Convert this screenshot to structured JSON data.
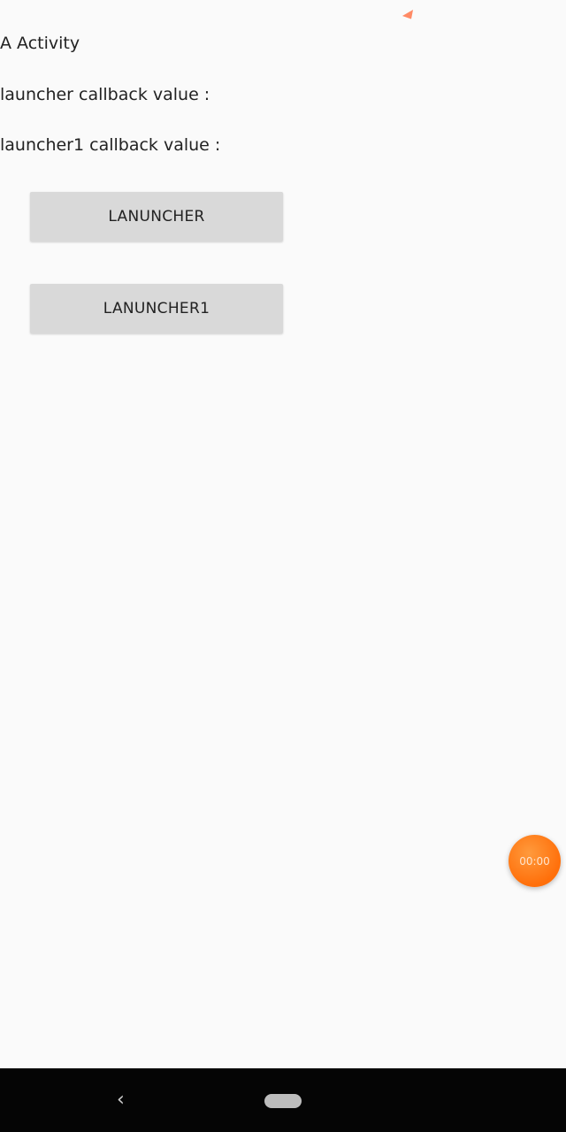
{
  "main": {
    "title": "A Activity",
    "launcher_callback_label": "launcher callback value :",
    "launcher1_callback_label": "launcher1 callback value :",
    "launcher_button_label": "LANUNCHER",
    "launcher1_button_label": "LANUNCHER1"
  },
  "overlay": {
    "timer_text": "00:00"
  },
  "navigation_bar": {
    "back_glyph": "‹"
  },
  "colors": {
    "background": "#fafafa",
    "button": "#d9d9d9",
    "fab": "#ff7a1a",
    "navbar": "#050505"
  }
}
